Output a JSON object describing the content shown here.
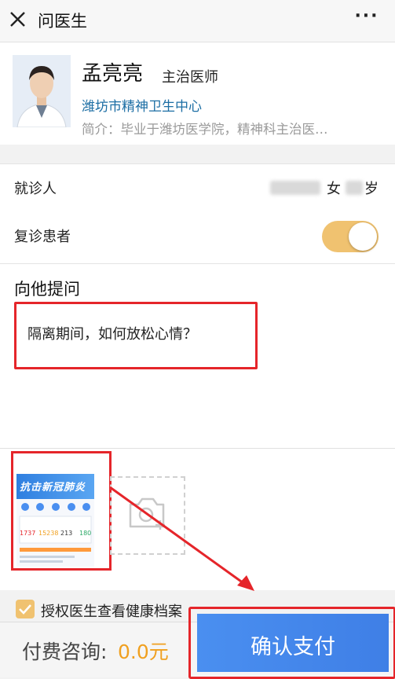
{
  "nav": {
    "title": "问医生",
    "more": "···"
  },
  "doctor": {
    "name": "孟亮亮",
    "title": "主治医师",
    "hospital": "潍坊市精神卫生中心",
    "intro": "简介：毕业于潍坊医学院，精神科主治医…"
  },
  "patient": {
    "label": "就诊人",
    "gender": "女",
    "age_unit": "岁"
  },
  "revisit": {
    "label": "复诊患者",
    "enabled": true
  },
  "question": {
    "heading": "向他提问",
    "text": "隔离期间，如何放松心情？"
  },
  "attachment": {
    "banner": "抗击新冠肺炎",
    "stats": [
      "1737",
      "15238",
      "213",
      "180"
    ]
  },
  "auth": {
    "label": "授权医生查看健康档案",
    "checked": true
  },
  "footer": {
    "fee_label": "付费咨询:",
    "fee_value": "0.0元",
    "pay_label": "确认支付"
  },
  "colors": {
    "accent": "#f0c270",
    "link": "#1c6ea4",
    "primary": "#3f7fe6",
    "highlight": "#e5252a"
  }
}
